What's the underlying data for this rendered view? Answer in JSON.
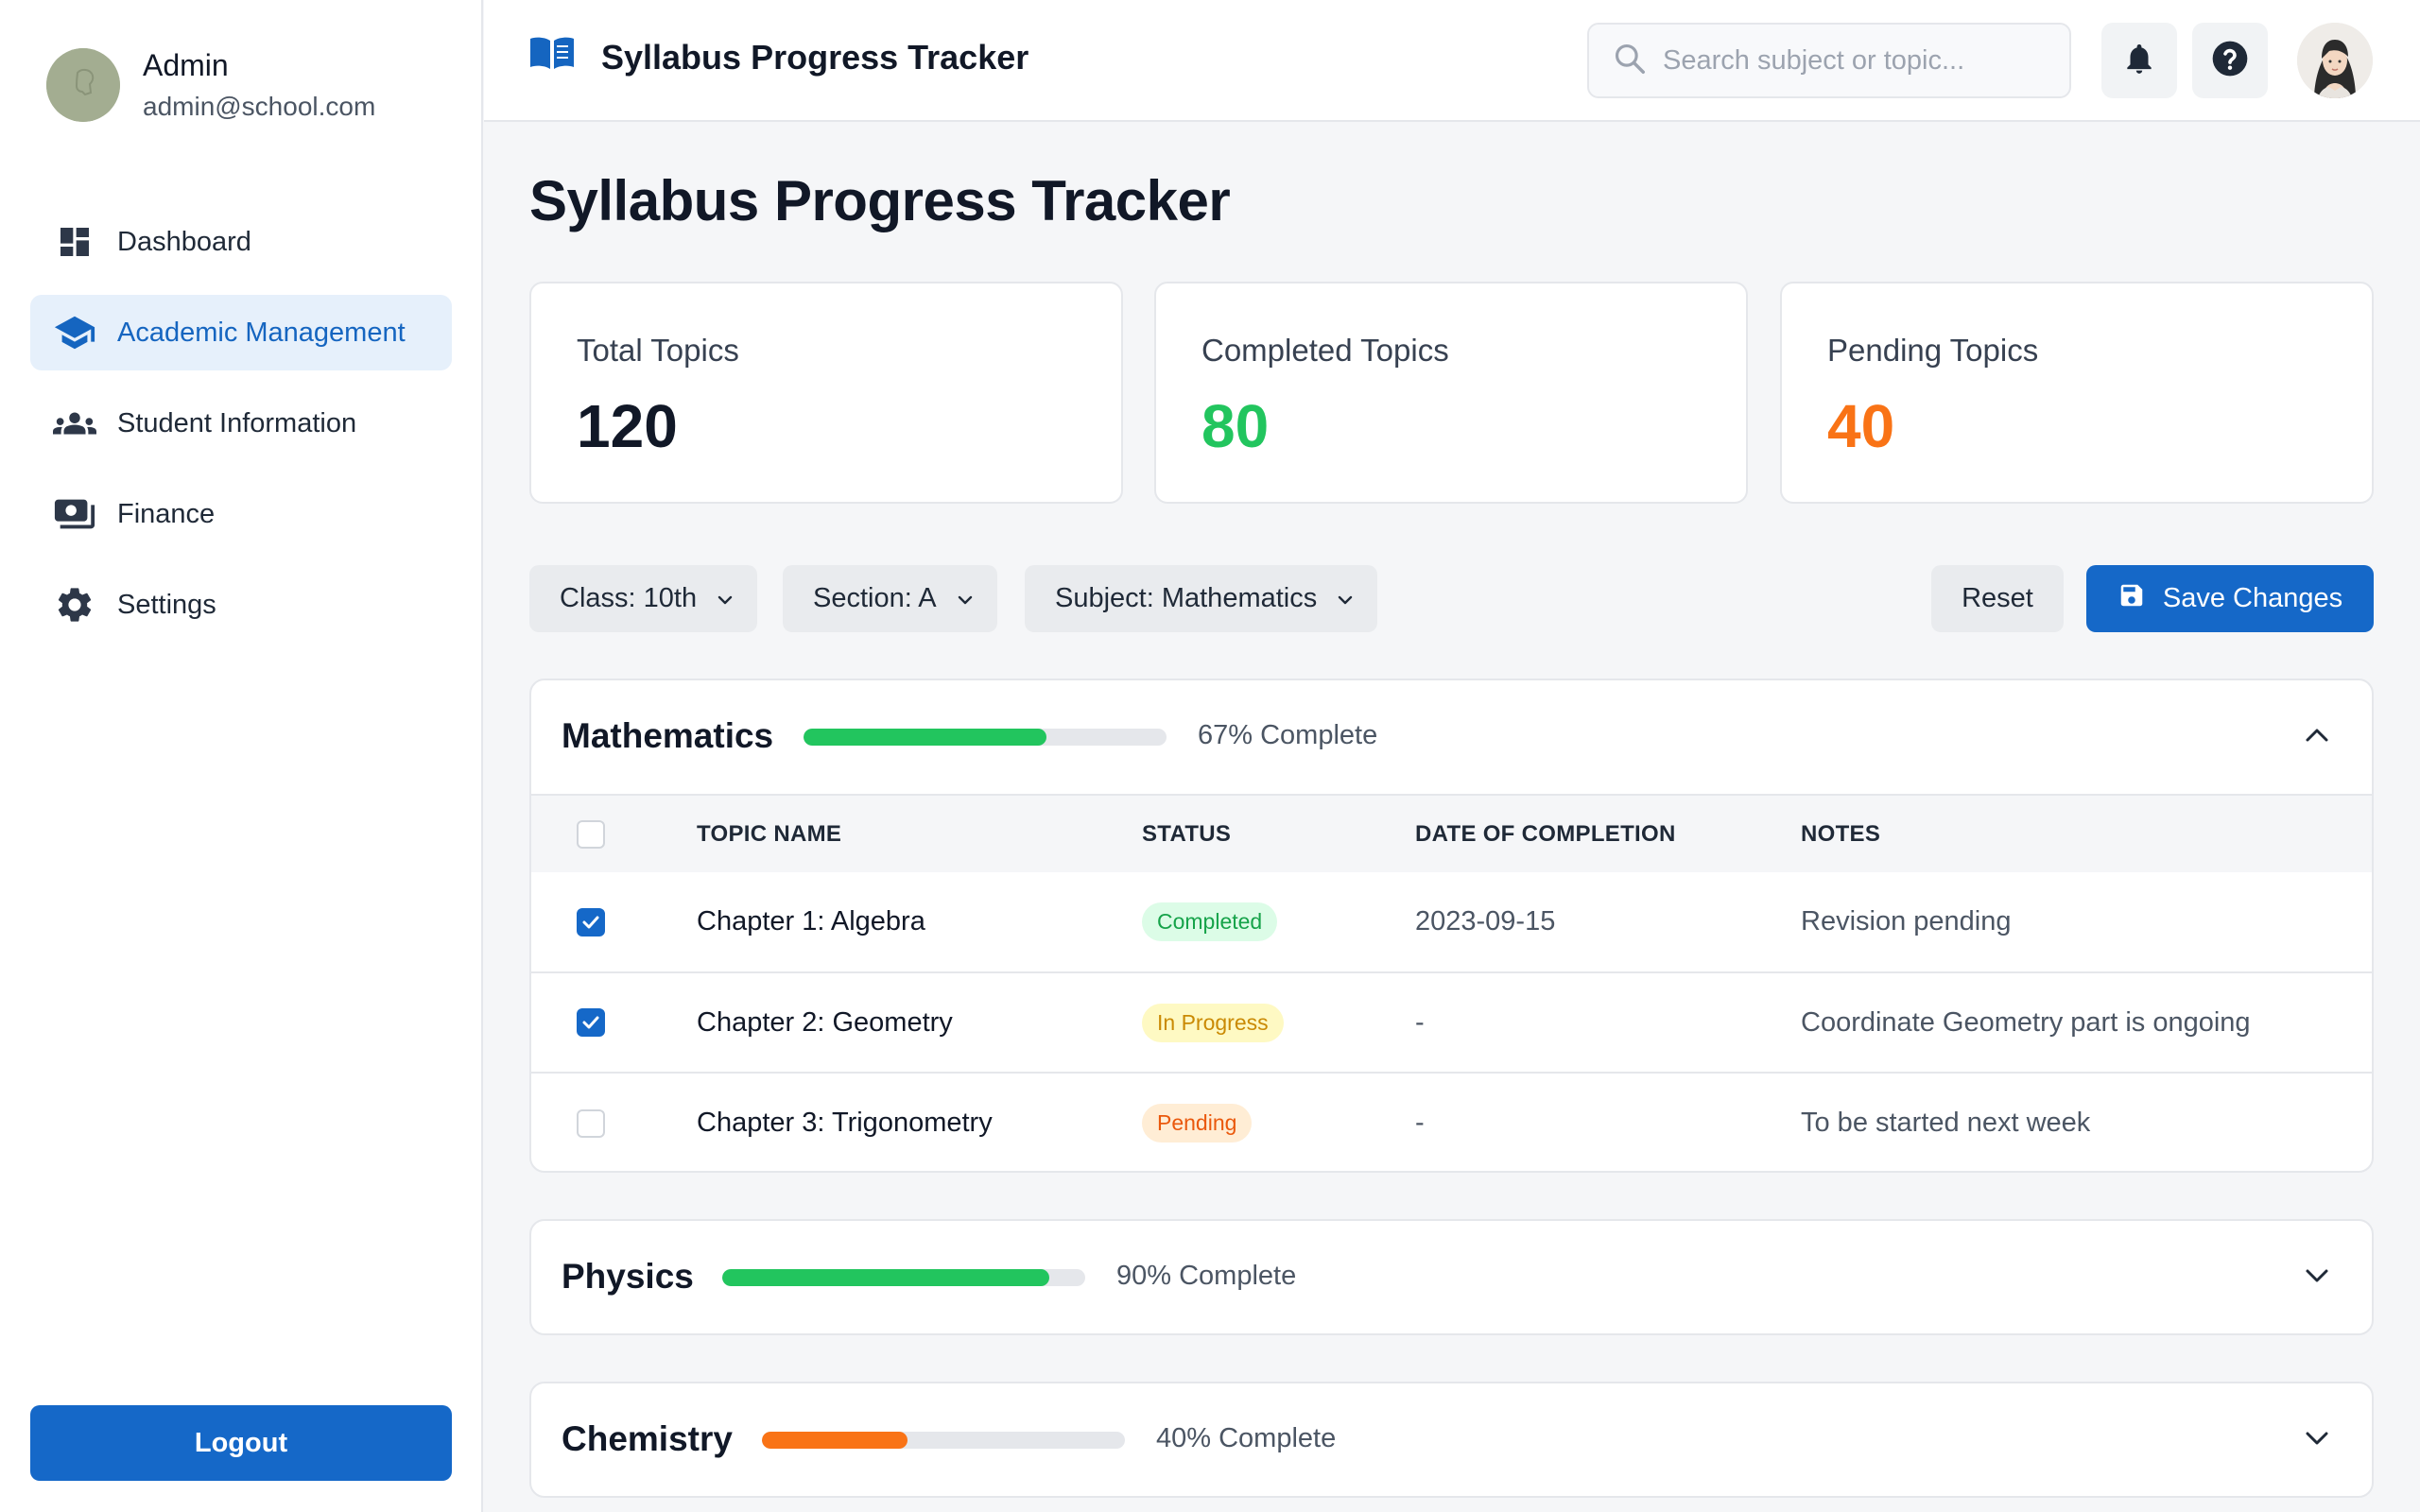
{
  "sidebar": {
    "user": {
      "name": "Admin",
      "email": "admin@school.com"
    },
    "items": [
      {
        "label": "Dashboard",
        "icon": "dashboard-icon"
      },
      {
        "label": "Academic Management",
        "icon": "graduation-cap-icon",
        "active": true
      },
      {
        "label": "Student Information",
        "icon": "people-icon"
      },
      {
        "label": "Finance",
        "icon": "money-icon"
      },
      {
        "label": "Settings",
        "icon": "gear-icon"
      }
    ],
    "logout_label": "Logout"
  },
  "header": {
    "title": "Syllabus Progress Tracker",
    "search_placeholder": "Search subject or topic..."
  },
  "page": {
    "title": "Syllabus Progress Tracker"
  },
  "stats": [
    {
      "label": "Total Topics",
      "value": "120",
      "color": "#111827"
    },
    {
      "label": "Completed Topics",
      "value": "80",
      "color": "#22c55e"
    },
    {
      "label": "Pending Topics",
      "value": "40",
      "color": "#f97316"
    }
  ],
  "filters": {
    "class": "Class: 10th",
    "section": "Section: A",
    "subject": "Subject: Mathematics",
    "reset_label": "Reset",
    "save_label": "Save Changes"
  },
  "table_headers": {
    "topic": "TOPIC NAME",
    "status": "STATUS",
    "date": "DATE OF COMPLETION",
    "notes": "NOTES"
  },
  "subjects": [
    {
      "name": "Mathematics",
      "progress": 0.67,
      "progress_label": "67% Complete",
      "bar_color": "#22c55e",
      "expanded": true,
      "topics": [
        {
          "name": "Chapter 1: Algebra",
          "status": "Completed",
          "date": "2023-09-15",
          "notes": "Revision pending",
          "checked": true
        },
        {
          "name": "Chapter 2: Geometry",
          "status": "In Progress",
          "date": "-",
          "notes": "Coordinate Geometry part is ongoing",
          "checked": true
        },
        {
          "name": "Chapter 3: Trigonometry",
          "status": "Pending",
          "date": "-",
          "notes": "To be started next week",
          "checked": false
        }
      ]
    },
    {
      "name": "Physics",
      "progress": 0.9,
      "progress_label": "90% Complete",
      "bar_color": "#22c55e",
      "expanded": false
    },
    {
      "name": "Chemistry",
      "progress": 0.4,
      "progress_label": "40% Complete",
      "bar_color": "#f97316",
      "expanded": false
    }
  ],
  "status_colors": {
    "Completed": {
      "bg": "#dcfce7",
      "fg": "#16a34a"
    },
    "In Progress": {
      "bg": "#fef9c3",
      "fg": "#ca8a04"
    },
    "Pending": {
      "bg": "#ffedd5",
      "fg": "#ea580c"
    }
  },
  "accent": "#1568c8"
}
